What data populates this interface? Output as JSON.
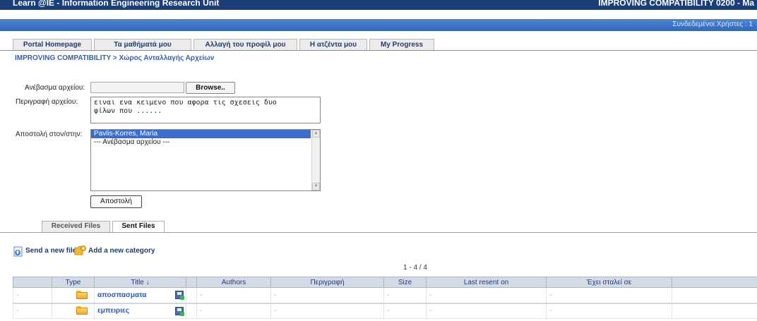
{
  "header": {
    "left_title": "Learn @IE - Information Engineering Research Unit",
    "right_title": "IMPROVING COMPATIBILITY 0200 - Ma"
  },
  "userbar": {
    "text": "Συνδεδεμένοι Χρήστες : 1"
  },
  "nav_tabs": [
    {
      "label": "Portal Homepage"
    },
    {
      "label": "Τα μαθήματά μου"
    },
    {
      "label": "Αλλαγή του προφίλ μου"
    },
    {
      "label": "Η ατζέντα μου"
    },
    {
      "label": "My Progress"
    }
  ],
  "breadcrumb": "IMPROVING COMPATIBILITY > Χώρος Ανταλλαγής Αρχείων",
  "form": {
    "upload_label": "Ανέβασμα αρχείου:",
    "browse_label": "Browse..",
    "description_label": "Περιγραφή αρχείου:",
    "description_value": "ειναι ενα κειμενο που αφορα τις σχεσεις δυο\nφίλων που ......",
    "recipient_label": "Αποστολή στον/στην:",
    "recipients": [
      {
        "label": "Pavlis-Korres, Maria",
        "selected": true
      },
      {
        "label": "--- Ανέβασμα αρχείου ---",
        "selected": false
      }
    ],
    "send_label": "Αποστολή"
  },
  "sub_tabs": [
    {
      "label": "Received Files",
      "active": false
    },
    {
      "label": "Sent Files",
      "active": true
    }
  ],
  "actions": {
    "send_new_file": "Send a new file",
    "add_category": "Add a new category"
  },
  "pager": "1 - 4 / 4",
  "table": {
    "headers": [
      "",
      "Type",
      "Title ↓",
      "",
      "Authors",
      "Περιγραφή",
      "Size",
      "Last resent on",
      "Έχει σταλεί σε",
      ""
    ],
    "rows": [
      {
        "cells": [
          "-",
          "",
          "αποσπασματα",
          "",
          "-",
          "-",
          "-",
          "-",
          "-",
          ""
        ]
      },
      {
        "cells": [
          "-",
          "",
          "εμπειριες",
          "",
          "-",
          "-",
          "-",
          "-",
          "-",
          ""
        ]
      }
    ]
  },
  "colors": {
    "header_bg": "#1a3f7a",
    "userbar_bg": "#3b72c8",
    "link": "#2d57a8",
    "table_header_bg": "#d4dbe6"
  }
}
